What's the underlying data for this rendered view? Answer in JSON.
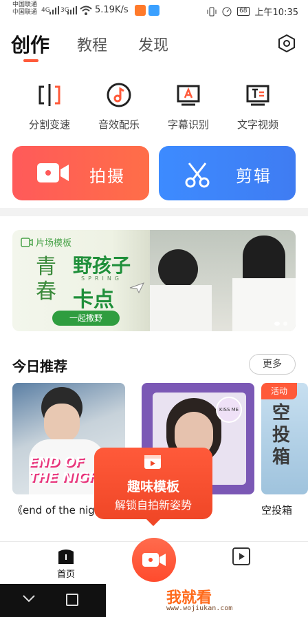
{
  "status_bar": {
    "carrier_1": "中国联通",
    "carrier_2": "中国联通",
    "signal_1": "4G",
    "signal_2": "3G",
    "speed": "5.19K/s",
    "battery": "68",
    "time": "上午10:35"
  },
  "top_tabs": [
    {
      "label": "创作",
      "active": true
    },
    {
      "label": "教程",
      "active": false
    },
    {
      "label": "发现",
      "active": false
    }
  ],
  "tools": [
    {
      "label": "分割变速",
      "icon": "split-icon"
    },
    {
      "label": "音效配乐",
      "icon": "music-note-icon"
    },
    {
      "label": "字幕识别",
      "icon": "subtitle-a-icon"
    },
    {
      "label": "文字视频",
      "icon": "text-video-icon"
    }
  ],
  "actions": {
    "shoot": "拍摄",
    "edit": "剪辑",
    "shoot_color": "#ff5a5a",
    "edit_color": "#3d8bff"
  },
  "banner": {
    "tag": "片场模板",
    "qing": "青",
    "chun": "春",
    "ye_hai_zi": "野孩子",
    "spring": "SPRING",
    "ka_dian": "卡点",
    "pill": "一起撒野"
  },
  "recommend": {
    "title": "今日推荐",
    "more": "更多",
    "cards": [
      {
        "caption": "《end of the nigh",
        "overlay_1": "END OF",
        "overlay_2": "THE NIGH"
      },
      {
        "caption": "",
        "badge": "KISS ME"
      },
      {
        "caption": "空投箱",
        "tag": "活动",
        "title": "空投箱"
      }
    ]
  },
  "popup": {
    "title": "趣味模板",
    "subtitle": "解锁自拍新姿势"
  },
  "bottom_nav": {
    "home": "首页"
  },
  "watermark": {
    "main": "我就看",
    "url": "www.wojiukan.com"
  }
}
